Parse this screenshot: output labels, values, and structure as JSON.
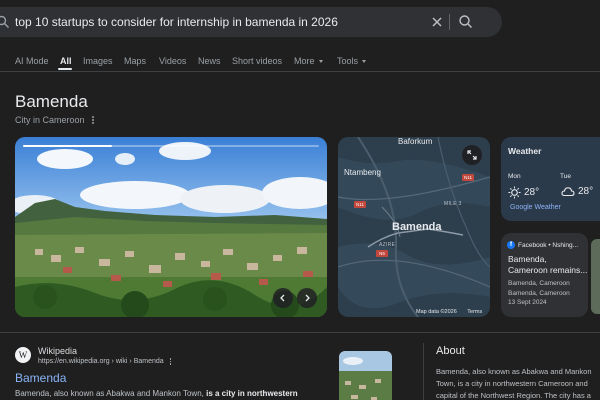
{
  "search": {
    "query": "top 10 startups to consider for internship in bamenda in 2026",
    "icons": {
      "lead": "search-icon",
      "clear": "close-icon",
      "submit": "search-icon"
    }
  },
  "tabs": [
    {
      "label": "AI Mode",
      "active": false
    },
    {
      "label": "All",
      "active": true
    },
    {
      "label": "Images",
      "active": false
    },
    {
      "label": "Maps",
      "active": false
    },
    {
      "label": "Videos",
      "active": false
    },
    {
      "label": "News",
      "active": false
    },
    {
      "label": "Short videos",
      "active": false
    },
    {
      "label": "More",
      "active": false,
      "dropdown": true
    },
    {
      "label": "Tools",
      "active": false,
      "dropdown": true
    }
  ],
  "entity": {
    "title": "Bamenda",
    "subtitle": "City in Cameroon"
  },
  "photo": {
    "progress": 0.3,
    "icons": {
      "prev": "chevron-left-icon",
      "next": "chevron-right-icon"
    }
  },
  "map": {
    "labels": {
      "baforkum": "Baforkum",
      "ntambeng": "Ntambeng",
      "city": "Bamenda",
      "mile3": "MILE 3",
      "azire": "AZIRE"
    },
    "shields": [
      "N11",
      "N11",
      "N6"
    ],
    "footer": {
      "data": "Map data ©2026",
      "terms": "Terms"
    },
    "icons": {
      "expand": "expand-icon"
    }
  },
  "weather": {
    "title": "Weather",
    "days": [
      {
        "day": "Mon",
        "temp": "28°",
        "icon": "sun-icon"
      },
      {
        "day": "Tue",
        "temp": "28°",
        "icon": "cloud-icon"
      }
    ],
    "source": "Google Weather"
  },
  "facebook": {
    "source": "Facebook • Nshing...",
    "headline": "Bamenda, Cameroon remains...",
    "snippet": "Bamenda, Cameroon Bamenda, Cameroon",
    "date": "13 Sept 2024",
    "icons": {
      "source": "facebook-icon"
    }
  },
  "result": {
    "site": "Wikipedia",
    "url": "https://en.wikipedia.org › wiki › Bamenda",
    "title": "Bamenda",
    "snippet_plain": "Bamenda, also known as Abakwa and Mankon Town, ",
    "snippet_bold": "is a city in northwestern",
    "favicon": "W"
  },
  "about": {
    "title": "About",
    "text": "Bamenda, also known as Abakwa and Mankon Town, is a city in northwestern Cameroon and capital of the Northwest Region. The city has a population of about six"
  },
  "colors": {
    "background": "#1f1f1f",
    "link": "#8ab4f8",
    "searchbar": "#303134",
    "weather_card": "#2b3a4a",
    "map_water": "#2d3e4c",
    "shield": "#c2473c"
  }
}
